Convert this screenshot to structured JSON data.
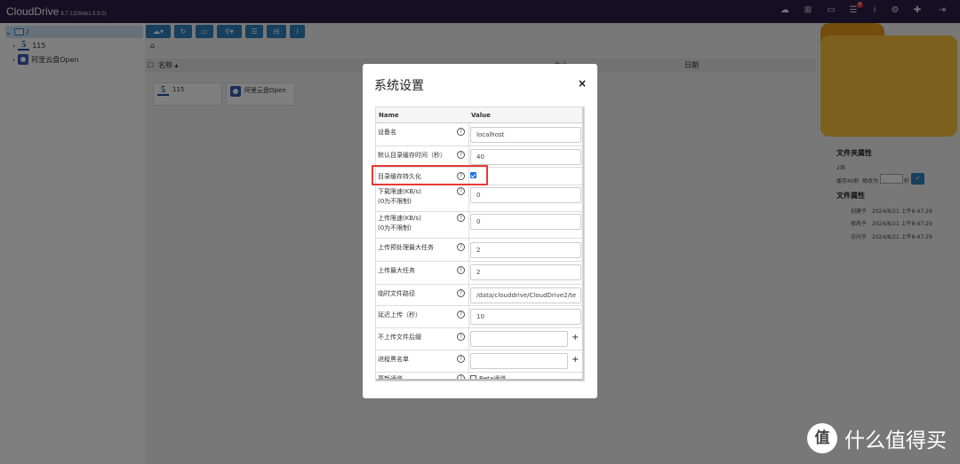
{
  "app": {
    "title": "CloudDrive",
    "version": "8.7.12(Web1.5.9.0)"
  },
  "topbar": {
    "notification_badge": "8"
  },
  "tree": {
    "root_label": "/",
    "items": [
      {
        "label": "115"
      },
      {
        "label": "阿里云盘Open"
      }
    ]
  },
  "toolbar": {
    "buttons": [
      "cloud-icon",
      "refresh-icon",
      "monitor-icon",
      "search-icon",
      "list-icon",
      "tree-icon",
      "info-icon"
    ]
  },
  "list": {
    "col_name": "名称",
    "col_size": "大小",
    "col_date": "日期",
    "items": [
      {
        "label": "115"
      },
      {
        "label": "阿里云盘Open"
      }
    ]
  },
  "right_panel": {
    "folder_props_title": "文件夹属性",
    "item_count": "2项",
    "cache_label": "缓存40秒",
    "change_to_label": "修改为",
    "seconds_label": "秒",
    "file_props_title": "文件属性",
    "created_label": "创建于",
    "created_value": "2024/8/21 上午8:47:29",
    "modified_label": "修改于",
    "modified_value": "2024/8/21 上午8:47:29",
    "accessed_label": "访问于",
    "accessed_value": "2024/8/21 上午8:47:29"
  },
  "modal": {
    "title": "系统设置",
    "close": "×",
    "col_name": "Name",
    "col_value": "Value",
    "rows": [
      {
        "label": "设备名",
        "value": "localhost"
      },
      {
        "label": "默认目录缓存时间（秒）",
        "value": "40"
      },
      {
        "label": "目录缓存持久化",
        "checked": true
      },
      {
        "label": "下载限速(KB/s)",
        "sub": "(0为不限制)",
        "value": "0"
      },
      {
        "label": "上传限速(KB/s)",
        "sub": "(0为不限制)",
        "value": "0"
      },
      {
        "label": "上传预处理最大任务",
        "value": "2"
      },
      {
        "label": "上传最大任务",
        "value": "2"
      },
      {
        "label": "临时文件路径",
        "value": "/data/clouddrive/CloudDrive2/te"
      },
      {
        "label": "延迟上传（秒）",
        "value": "10"
      },
      {
        "label": "不上传文件后缀",
        "value": ""
      },
      {
        "label": "进程黑名单",
        "value": ""
      },
      {
        "label": "更新通道",
        "value": "Beta通道"
      }
    ]
  },
  "watermark": {
    "logo": "值",
    "text": "什么值得买"
  }
}
